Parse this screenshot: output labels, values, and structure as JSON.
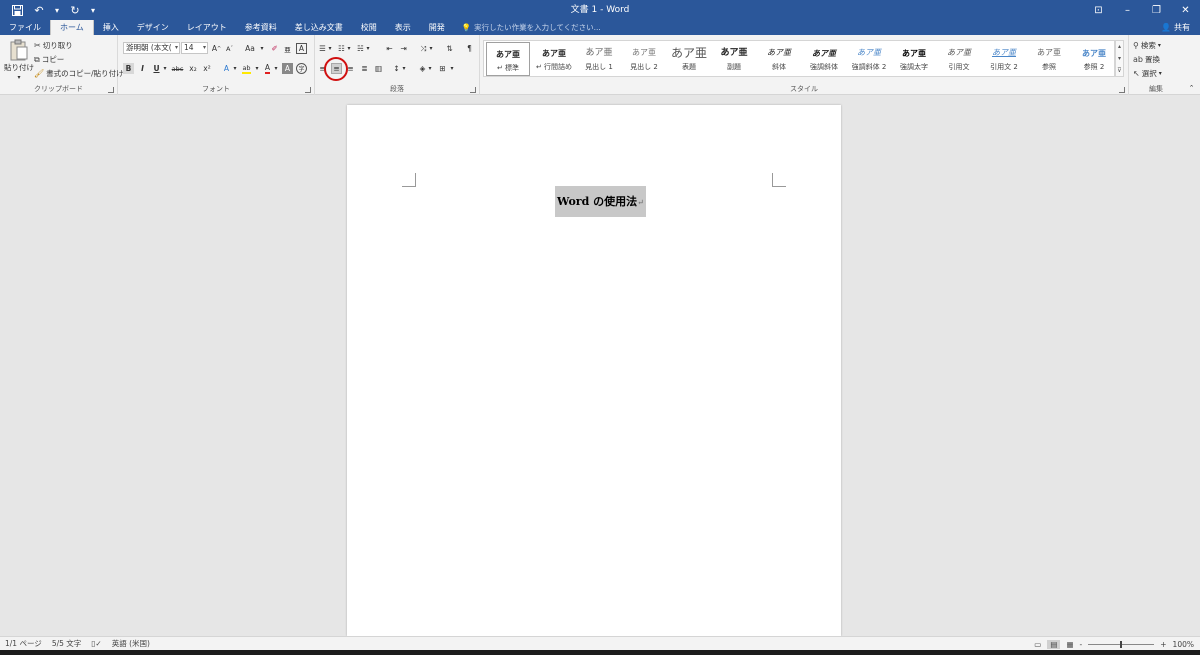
{
  "app": {
    "window_title": "文書 1 - Word"
  },
  "quick_access": {
    "save_icon": "save-icon",
    "undo_icon": "undo-icon",
    "redo_icon": "redo-icon",
    "customize_icon": "customize-icon"
  },
  "tabs": [
    {
      "label": "ファイル"
    },
    {
      "label": "ホーム"
    },
    {
      "label": "挿入"
    },
    {
      "label": "デザイン"
    },
    {
      "label": "レイアウト"
    },
    {
      "label": "参考資料"
    },
    {
      "label": "差し込み文書"
    },
    {
      "label": "校閲"
    },
    {
      "label": "表示"
    },
    {
      "label": "開発"
    }
  ],
  "tell_me": {
    "placeholder": "実行したい作業を入力してください..."
  },
  "share": {
    "label": "共有"
  },
  "clipboard": {
    "group_label": "クリップボード",
    "paste_label": "貼り付け",
    "cut_label": "切り取り",
    "copy_label": "コピー",
    "format_painter_label": "書式のコピー/貼り付け"
  },
  "font": {
    "group_label": "フォント",
    "font_name": "游明朝 (本文(",
    "font_size": "14",
    "grow_label": "A",
    "shrink_label": "A",
    "case_label": "Aa",
    "bold_label": "B",
    "italic_label": "I",
    "underline_label": "U",
    "strike_label": "abc",
    "sub_label": "x₂",
    "sup_label": "x²",
    "effects_label": "A",
    "highlight_label": "ab",
    "color_label": "A",
    "shading_label": "A",
    "enclose_label": "字",
    "phonetic_label": "亜",
    "border_char_label": "A"
  },
  "paragraph": {
    "group_label": "段落"
  },
  "styles": {
    "group_label": "スタイル",
    "items": [
      {
        "preview": "あア亜",
        "name": "↵ 標準"
      },
      {
        "preview": "あア亜",
        "name": "↵ 行間詰め"
      },
      {
        "preview": "あア亜",
        "name": "見出し 1"
      },
      {
        "preview": "あア亜",
        "name": "見出し 2"
      },
      {
        "preview": "あア亜",
        "name": "表題"
      },
      {
        "preview": "あア亜",
        "name": "副題"
      },
      {
        "preview": "あア亜",
        "name": "斜体"
      },
      {
        "preview": "あア亜",
        "name": "強調斜体"
      },
      {
        "preview": "あア亜",
        "name": "強調斜体 2"
      },
      {
        "preview": "あア亜",
        "name": "強調太字"
      },
      {
        "preview": "あア亜",
        "name": "引用文"
      },
      {
        "preview": "あア亜",
        "name": "引用文 2"
      },
      {
        "preview": "あア亜",
        "name": "参照"
      },
      {
        "preview": "あア亜",
        "name": "参照 2"
      }
    ]
  },
  "editing": {
    "group_label": "編集",
    "find_label": "検索",
    "replace_label": "置換",
    "select_label": "選択"
  },
  "document": {
    "title_text": "Word の使用法",
    "pilcrow": "↵"
  },
  "status": {
    "page": "1/1 ページ",
    "words": "5/5 文字",
    "language": "英語 (米国)",
    "zoom": "100%",
    "zoom_minus": "-",
    "zoom_plus": "+"
  },
  "colors": {
    "title_bar": "#2b579a",
    "ribbon_bg": "#f3f3f3",
    "workspace_bg": "#e6e6e6",
    "highlight_circle": "#d01010"
  }
}
